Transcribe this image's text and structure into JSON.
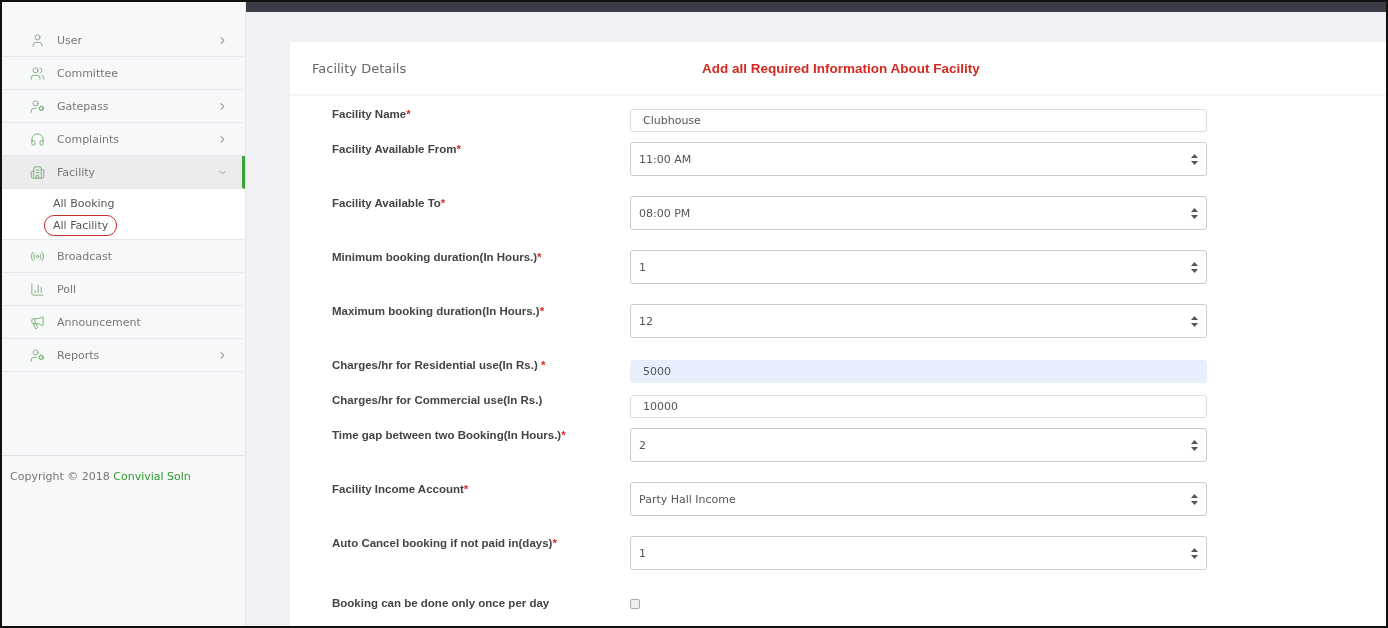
{
  "sidebar": {
    "items": [
      {
        "label": "User",
        "has_children": true,
        "expanded": false
      },
      {
        "label": "Committee",
        "has_children": false,
        "expanded": false
      },
      {
        "label": "Gatepass",
        "has_children": true,
        "expanded": false
      },
      {
        "label": "Complaints",
        "has_children": true,
        "expanded": false
      },
      {
        "label": "Facility",
        "has_children": true,
        "expanded": true,
        "children": [
          {
            "label": "All Booking",
            "circled": false
          },
          {
            "label": "All Facility",
            "circled": true
          }
        ]
      },
      {
        "label": "Broadcast",
        "has_children": false,
        "expanded": false
      },
      {
        "label": "Poll",
        "has_children": false,
        "expanded": false
      },
      {
        "label": "Announcement",
        "has_children": false,
        "expanded": false
      },
      {
        "label": "Reports",
        "has_children": true,
        "expanded": false
      }
    ],
    "copyright": {
      "text": "Copyright © 2018",
      "link": "Convivial Soln"
    }
  },
  "card": {
    "title": "Facility Details",
    "notice": "Add all Required Information About Facility",
    "fields": [
      {
        "kind": "text",
        "label": "Facility Name",
        "mark": "*",
        "value": "Clubhouse",
        "autofilled": false
      },
      {
        "kind": "select",
        "label": "Facility Available From",
        "mark": "*",
        "value": "11:00 AM"
      },
      {
        "kind": "select",
        "label": "Facility Available To",
        "mark": "*",
        "value": "08:00 PM"
      },
      {
        "kind": "select",
        "label": "Minimum booking duration(In Hours.)",
        "mark": "*",
        "value": "1"
      },
      {
        "kind": "select",
        "label": "Maximum booking duration(In Hours.)",
        "mark": "*",
        "value": "12"
      },
      {
        "kind": "text",
        "label": "Charges/hr for Residential use(In Rs.)",
        "mark": "*",
        "value": "5000",
        "autofilled": true
      },
      {
        "kind": "text",
        "label": "Charges/hr for Commercial use(In Rs.)",
        "value": "10000",
        "autofilled": false
      },
      {
        "kind": "select",
        "label": "Time gap between two Booking(In Hours.)",
        "mark": "*",
        "value": "2"
      },
      {
        "kind": "select",
        "label": "Facility Income Account",
        "mark": "*",
        "value": "Party Hall Income"
      },
      {
        "kind": "select",
        "label": "Auto Cancel booking if not paid in(days)",
        "mark": "*",
        "value": "1"
      },
      {
        "kind": "checkbox",
        "label": "Booking can be done only once per day",
        "checked": false
      }
    ]
  }
}
